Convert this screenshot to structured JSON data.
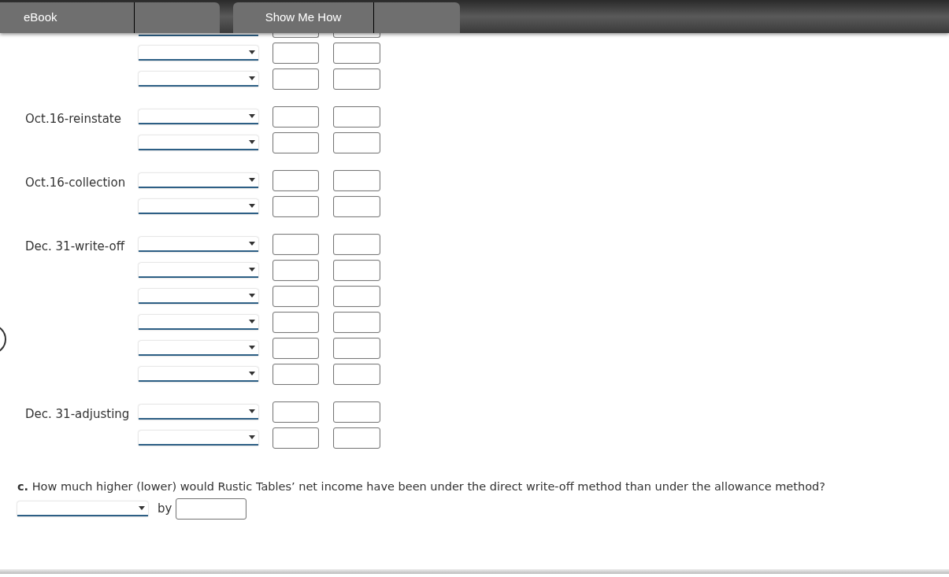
{
  "header": {
    "tabs": [
      {
        "label": "eBook"
      },
      {
        "label": "Show Me How"
      }
    ]
  },
  "entries": [
    {
      "rows": [
        {
          "kind": "partial"
        },
        {
          "kind": "entry"
        },
        {
          "kind": "entry"
        }
      ]
    },
    {
      "label": "Oct.16-reinstate",
      "rows": [
        {
          "kind": "entry"
        },
        {
          "kind": "entry"
        }
      ]
    },
    {
      "label": "Oct.16-collection",
      "rows": [
        {
          "kind": "entry"
        },
        {
          "kind": "entry"
        }
      ]
    },
    {
      "label": "Dec. 31-write-off",
      "rows": [
        {
          "kind": "entry"
        },
        {
          "kind": "entry"
        },
        {
          "kind": "entry"
        },
        {
          "kind": "entry"
        },
        {
          "kind": "entry"
        },
        {
          "kind": "entry"
        }
      ]
    },
    {
      "label": "Dec. 31-adjusting",
      "rows": [
        {
          "kind": "entry"
        },
        {
          "kind": "entry"
        }
      ]
    }
  ],
  "question": {
    "text": "**c.** How much higher (lower) would Rustic Tables’ net income have been under the direct write-off method than under the allowance method?",
    "connector": "by"
  }
}
